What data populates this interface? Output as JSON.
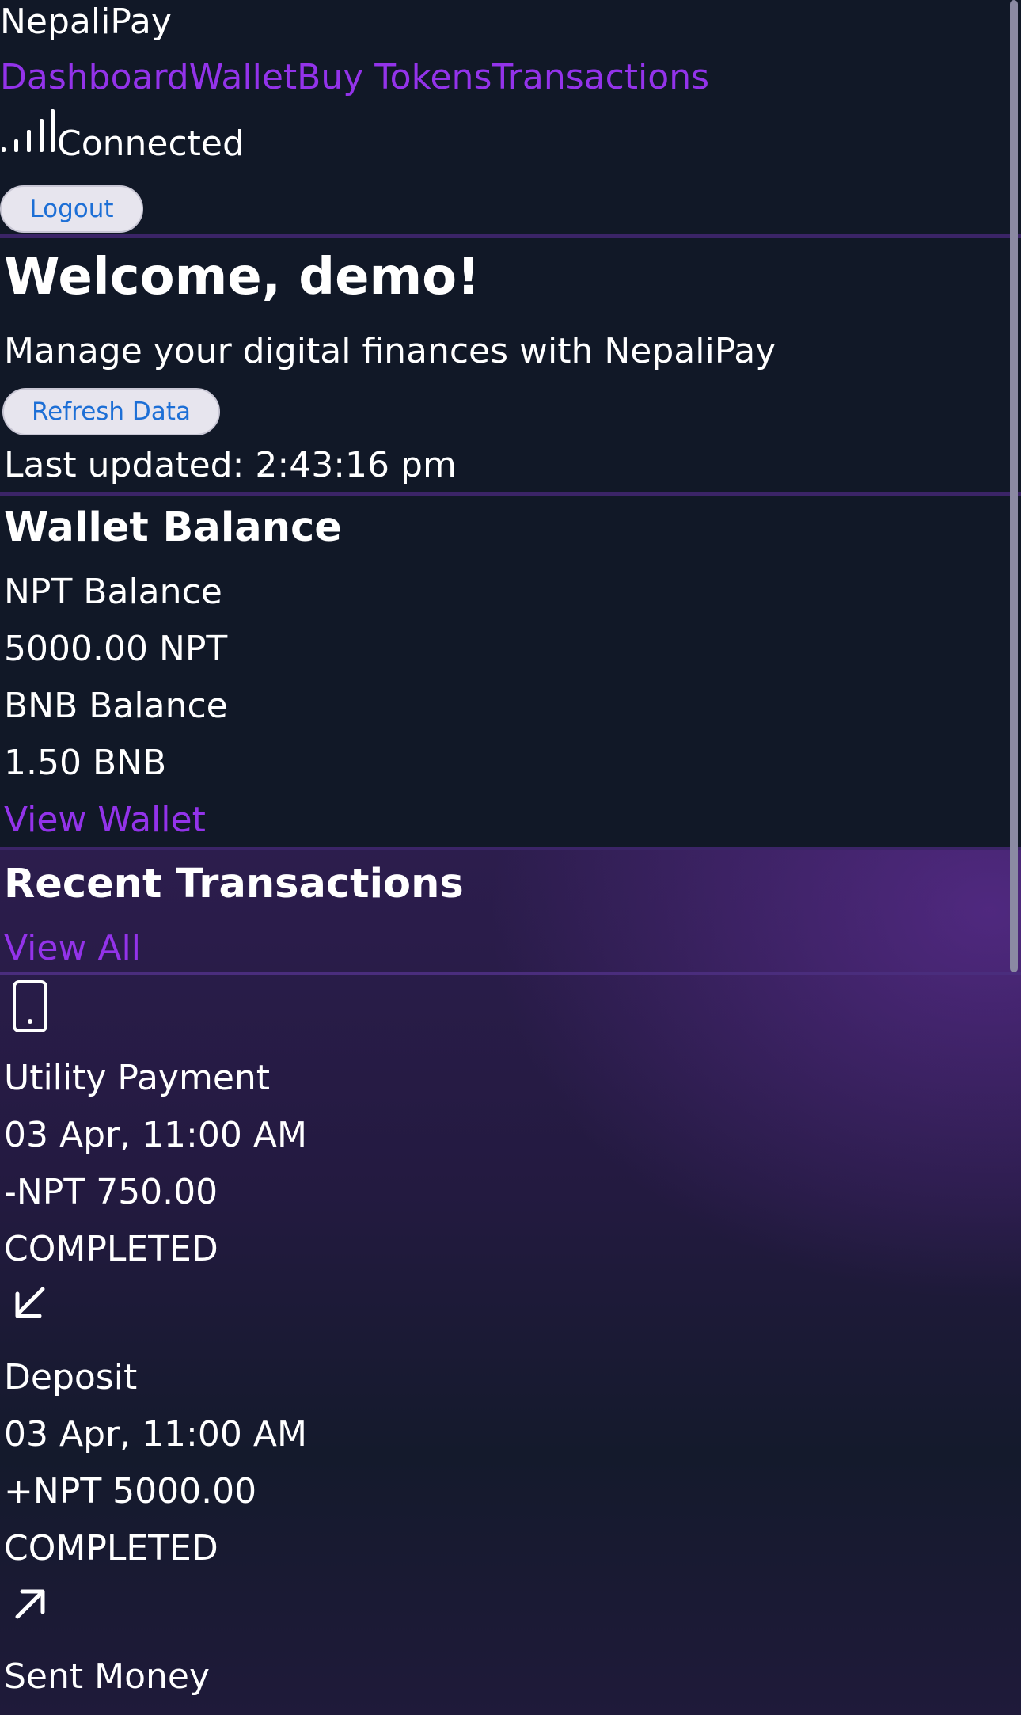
{
  "header": {
    "brand": "NepaliPay",
    "nav": [
      "Dashboard",
      "Wallet",
      "Buy Tokens",
      "Transactions"
    ],
    "connection_status": "Connected",
    "logout_label": "Logout"
  },
  "welcome": {
    "title": "Welcome, demo!",
    "subtitle": "Manage your digital finances with NepaliPay",
    "refresh_label": "Refresh Data",
    "last_updated": "Last updated: 2:43:16 pm"
  },
  "wallet": {
    "title": "Wallet Balance",
    "npt_label": "NPT Balance",
    "npt_value": "5000.00 NPT",
    "bnb_label": "BNB Balance",
    "bnb_value": "1.50 BNB",
    "view_link": "View Wallet"
  },
  "recent": {
    "title": "Recent Transactions",
    "view_all": "View All",
    "transactions": [
      {
        "icon": "phone-icon",
        "name": "Utility Payment",
        "date": "03 Apr, 11:00 AM",
        "amount": "-NPT 750.00",
        "status": "COMPLETED"
      },
      {
        "icon": "arrow-down-left-icon",
        "name": "Deposit",
        "date": "03 Apr, 11:00 AM",
        "amount": "+NPT 5000.00",
        "status": "COMPLETED"
      },
      {
        "icon": "arrow-up-right-icon",
        "name": "Sent Money"
      }
    ]
  },
  "colors": {
    "background": "#111827",
    "accent": "#9333ea",
    "button_text": "#1d6fd6",
    "divider": "#3b2467"
  }
}
